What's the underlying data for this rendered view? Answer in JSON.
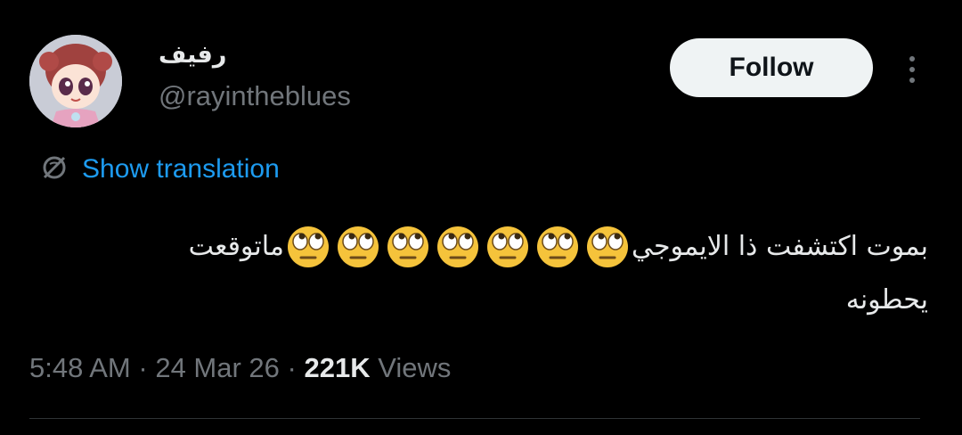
{
  "author": {
    "display_name": "رفيف",
    "handle": "@rayintheblues"
  },
  "follow_label": "Follow",
  "translation_label": "Show translation",
  "tweet": {
    "line1_start": "بموت اكتشفت ذا الايموجي",
    "line1_end": "ماتوقعت",
    "line2": "يحطونه",
    "emoji_count": 7,
    "emoji_name": "face-with-rolling-eyes-icon"
  },
  "meta": {
    "time": "5:48 AM",
    "sep1": "·",
    "date": "24 Mar 26",
    "sep2": "·",
    "views_count": "221K",
    "views_label": "Views"
  },
  "colors": {
    "background": "#000000",
    "text": "#e7e9ea",
    "secondary": "#71767b",
    "link": "#1d9bf0",
    "button_bg": "#eff3f4"
  }
}
